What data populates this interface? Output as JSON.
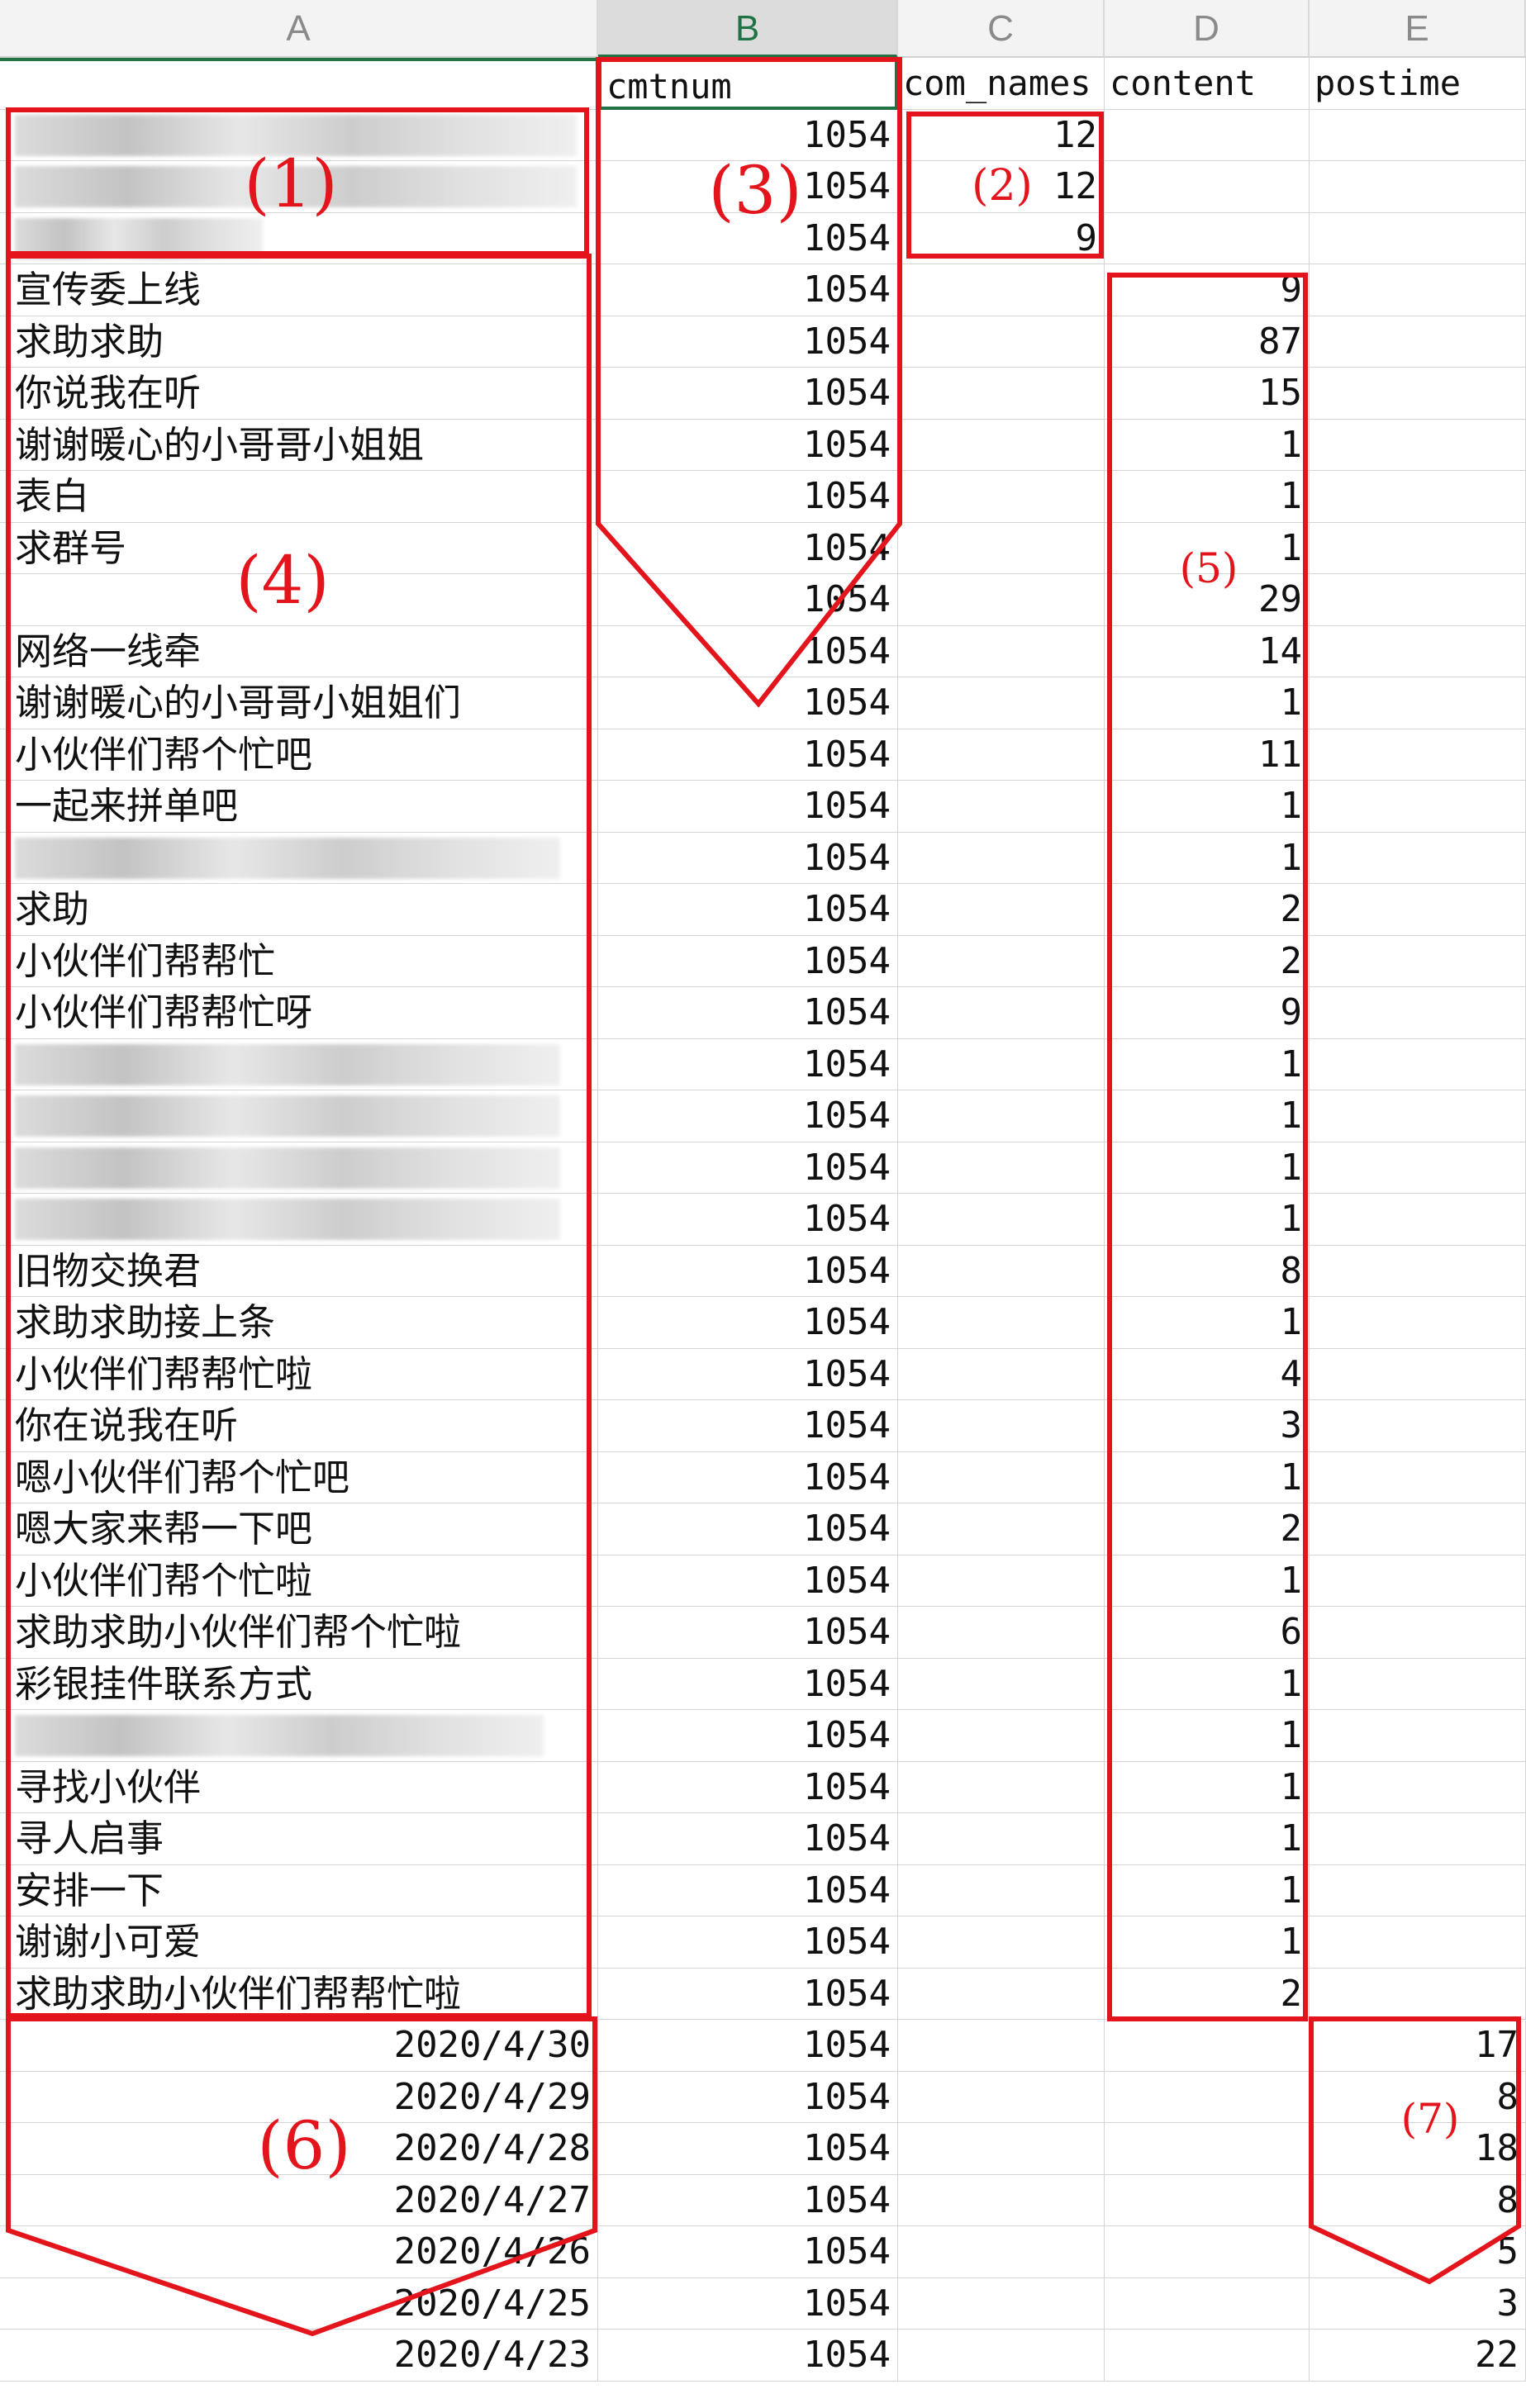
{
  "columns": [
    "A",
    "B",
    "C",
    "D",
    "E"
  ],
  "active_column": "B",
  "field_names": {
    "B": "cmtnum",
    "C": "com_names",
    "D": "content",
    "E": "postime"
  },
  "markers": [
    "(1)",
    "(2)",
    "(3)",
    "(4)",
    "(5)",
    "(6)",
    "(7)"
  ],
  "rows": [
    {
      "a": "",
      "b": "1054",
      "c": "12",
      "d": "",
      "e": ""
    },
    {
      "a": "",
      "b": "1054",
      "c": "12",
      "d": "",
      "e": ""
    },
    {
      "a": "",
      "b": "1054",
      "c": "9",
      "d": "",
      "e": ""
    },
    {
      "a": "宣传委上线",
      "b": "1054",
      "c": "",
      "d": "9",
      "e": ""
    },
    {
      "a": "求助求助",
      "b": "1054",
      "c": "",
      "d": "87",
      "e": ""
    },
    {
      "a": "你说我在听",
      "b": "1054",
      "c": "",
      "d": "15",
      "e": ""
    },
    {
      "a": "谢谢暖心的小哥哥小姐姐",
      "b": "1054",
      "c": "",
      "d": "1",
      "e": ""
    },
    {
      "a": "表白",
      "b": "1054",
      "c": "",
      "d": "1",
      "e": ""
    },
    {
      "a": "求群号",
      "b": "1054",
      "c": "",
      "d": "1",
      "e": ""
    },
    {
      "a": "",
      "b": "1054",
      "c": "",
      "d": "29",
      "e": ""
    },
    {
      "a": "网络一线牵",
      "b": "1054",
      "c": "",
      "d": "14",
      "e": ""
    },
    {
      "a": "谢谢暖心的小哥哥小姐姐们",
      "b": "1054",
      "c": "",
      "d": "1",
      "e": ""
    },
    {
      "a": "小伙伴们帮个忙吧",
      "b": "1054",
      "c": "",
      "d": "11",
      "e": ""
    },
    {
      "a": "一起来拼单吧",
      "b": "1054",
      "c": "",
      "d": "1",
      "e": ""
    },
    {
      "a": "",
      "b": "1054",
      "c": "",
      "d": "1",
      "e": ""
    },
    {
      "a": "求助",
      "b": "1054",
      "c": "",
      "d": "2",
      "e": ""
    },
    {
      "a": "小伙伴们帮帮忙",
      "b": "1054",
      "c": "",
      "d": "2",
      "e": ""
    },
    {
      "a": "小伙伴们帮帮忙呀",
      "b": "1054",
      "c": "",
      "d": "9",
      "e": ""
    },
    {
      "a": "",
      "b": "1054",
      "c": "",
      "d": "1",
      "e": ""
    },
    {
      "a": "",
      "b": "1054",
      "c": "",
      "d": "1",
      "e": ""
    },
    {
      "a": "",
      "b": "1054",
      "c": "",
      "d": "1",
      "e": ""
    },
    {
      "a": "",
      "b": "1054",
      "c": "",
      "d": "1",
      "e": ""
    },
    {
      "a": "旧物交换君",
      "b": "1054",
      "c": "",
      "d": "8",
      "e": ""
    },
    {
      "a": "求助求助接上条",
      "b": "1054",
      "c": "",
      "d": "1",
      "e": ""
    },
    {
      "a": "小伙伴们帮帮忙啦",
      "b": "1054",
      "c": "",
      "d": "4",
      "e": ""
    },
    {
      "a": "你在说我在听",
      "b": "1054",
      "c": "",
      "d": "3",
      "e": ""
    },
    {
      "a": "嗯小伙伴们帮个忙吧",
      "b": "1054",
      "c": "",
      "d": "1",
      "e": ""
    },
    {
      "a": "嗯大家来帮一下吧",
      "b": "1054",
      "c": "",
      "d": "2",
      "e": ""
    },
    {
      "a": "小伙伴们帮个忙啦",
      "b": "1054",
      "c": "",
      "d": "1",
      "e": ""
    },
    {
      "a": "求助求助小伙伴们帮个忙啦",
      "b": "1054",
      "c": "",
      "d": "6",
      "e": ""
    },
    {
      "a": "彩银挂件联系方式",
      "b": "1054",
      "c": "",
      "d": "1",
      "e": ""
    },
    {
      "a": "",
      "b": "1054",
      "c": "",
      "d": "1",
      "e": ""
    },
    {
      "a": "寻找小伙伴",
      "b": "1054",
      "c": "",
      "d": "1",
      "e": ""
    },
    {
      "a": "寻人启事",
      "b": "1054",
      "c": "",
      "d": "1",
      "e": ""
    },
    {
      "a": "安排一下",
      "b": "1054",
      "c": "",
      "d": "1",
      "e": ""
    },
    {
      "a": "谢谢小可爱",
      "b": "1054",
      "c": "",
      "d": "1",
      "e": ""
    },
    {
      "a": "求助求助小伙伴们帮帮忙啦",
      "b": "1054",
      "c": "",
      "d": "2",
      "e": ""
    },
    {
      "a": "2020/4/30",
      "b": "1054",
      "c": "",
      "d": "",
      "e": "17"
    },
    {
      "a": "2020/4/29",
      "b": "1054",
      "c": "",
      "d": "",
      "e": "8"
    },
    {
      "a": "2020/4/28",
      "b": "1054",
      "c": "",
      "d": "",
      "e": "18"
    },
    {
      "a": "2020/4/27",
      "b": "1054",
      "c": "",
      "d": "",
      "e": "8"
    },
    {
      "a": "2020/4/26",
      "b": "1054",
      "c": "",
      "d": "",
      "e": "5"
    },
    {
      "a": "2020/4/25",
      "b": "1054",
      "c": "",
      "d": "",
      "e": "3"
    },
    {
      "a": "2020/4/23",
      "b": "1054",
      "c": "",
      "d": "",
      "e": "22"
    }
  ]
}
